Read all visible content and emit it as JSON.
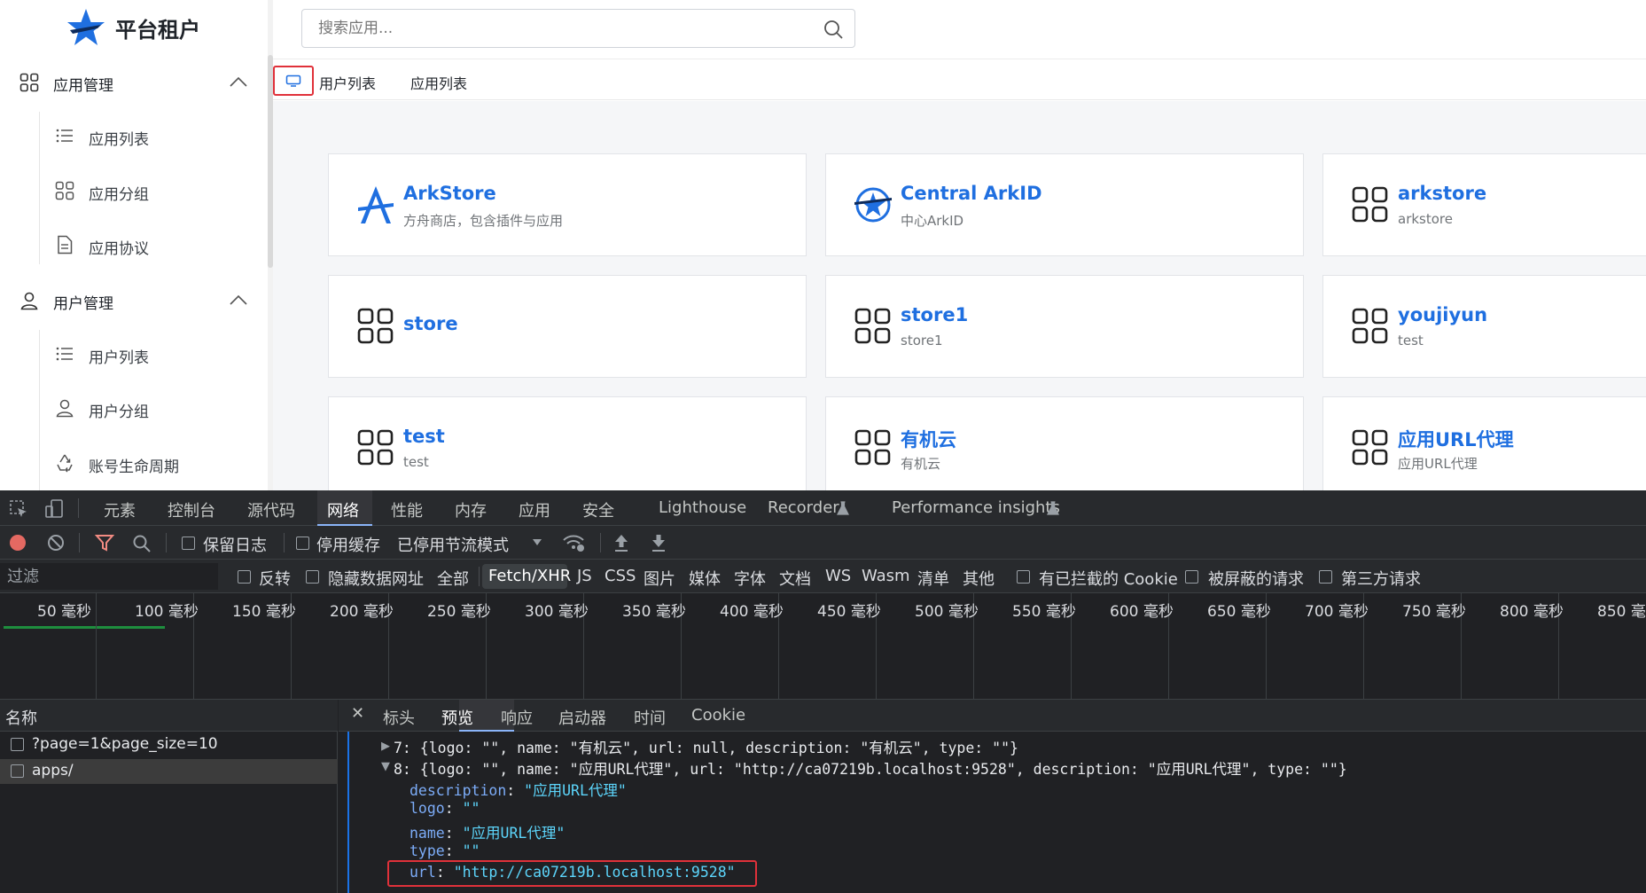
{
  "brand": {
    "title": "平台租户",
    "color": "#1f6fe0"
  },
  "search": {
    "placeholder": "搜索应用..."
  },
  "sidebar": {
    "groups": [
      {
        "label": "应用管理",
        "items": [
          "应用列表",
          "应用分组",
          "应用协议"
        ]
      },
      {
        "label": "用户管理",
        "items": [
          "用户列表",
          "用户分组",
          "账号生命周期"
        ]
      }
    ]
  },
  "tabs": [
    "用户列表",
    "应用列表"
  ],
  "apps": [
    {
      "name": "ArkStore",
      "desc": "方舟商店，包含插件与应用",
      "icon": "arkstore-logo"
    },
    {
      "name": "Central ArkID",
      "desc": "中心ArkID",
      "icon": "arkid-logo"
    },
    {
      "name": "arkstore",
      "desc": "arkstore",
      "icon": "grid-icon"
    },
    {
      "name": "store",
      "desc": "",
      "icon": "grid-icon"
    },
    {
      "name": "store1",
      "desc": "store1",
      "icon": "grid-icon"
    },
    {
      "name": "youjiyun",
      "desc": "test",
      "icon": "grid-icon"
    },
    {
      "name": "test",
      "desc": "test",
      "icon": "grid-icon"
    },
    {
      "name": "有机云",
      "desc": "有机云",
      "icon": "grid-icon"
    },
    {
      "name": "应用URL代理",
      "desc": "应用URL代理",
      "icon": "grid-icon"
    }
  ],
  "devtools": {
    "tabs": [
      "元素",
      "控制台",
      "源代码",
      "网络",
      "性能",
      "内存",
      "应用",
      "安全",
      "Lighthouse",
      "Recorder",
      "Performance insights"
    ],
    "active_tab": "网络",
    "toolbar": {
      "preserve_log": "保留日志",
      "disable_cache": "停用缓存",
      "throttle": "已停用节流模式"
    },
    "filter": {
      "placeholder": "过滤",
      "invert": "反转",
      "hide_data_urls": "隐藏数据网址",
      "types": [
        "全部",
        "Fetch/XHR",
        "JS",
        "CSS",
        "图片",
        "媒体",
        "字体",
        "文档",
        "WS",
        "Wasm",
        "清单",
        "其他"
      ],
      "active_type": "Fetch/XHR",
      "blocked_cookies": "有已拦截的 Cookie",
      "blocked_requests": "被屏蔽的请求",
      "third_party": "第三方请求"
    },
    "timeline": [
      "50 毫秒",
      "100 毫秒",
      "150 毫秒",
      "200 毫秒",
      "250 毫秒",
      "300 毫秒",
      "350 毫秒",
      "400 毫秒",
      "450 毫秒",
      "500 毫秒",
      "550 毫秒",
      "600 毫秒",
      "650 毫秒",
      "700 毫秒",
      "750 毫秒",
      "800 毫秒",
      "850 毫秒"
    ],
    "name_header": "名称",
    "requests": [
      "?page=1&page_size=10",
      "apps/"
    ],
    "preview_tabs": [
      "标头",
      "预览",
      "响应",
      "启动器",
      "时间",
      "Cookie"
    ],
    "active_preview_tab": "预览",
    "preview": {
      "line7": "7: {logo: \"\", name: \"有机云\", url: null, description: \"有机云\", type: \"\"}",
      "line8": "8: {logo: \"\", name: \"应用URL代理\", url: \"http://ca07219b.localhost:9528\", description: \"应用URL代理\", type: \"\"}",
      "fields": [
        {
          "key": "description",
          "value": "\"应用URL代理\""
        },
        {
          "key": "logo",
          "value": "\"\""
        },
        {
          "key": "name",
          "value": "\"应用URL代理\""
        },
        {
          "key": "type",
          "value": "\"\""
        },
        {
          "key": "url",
          "value": "\"http://ca07219b.localhost:9528\""
        }
      ]
    }
  }
}
